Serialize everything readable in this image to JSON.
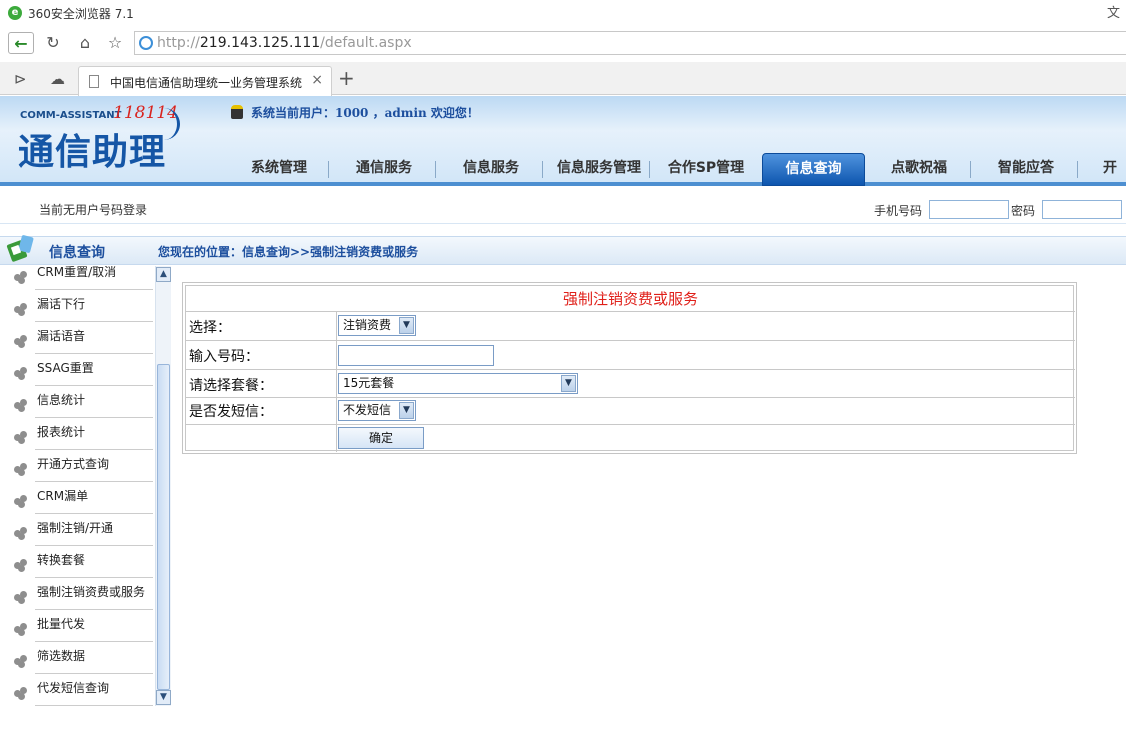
{
  "browser": {
    "title": "360安全浏览器 7.1",
    "right_text": "文",
    "url_scheme": "http://",
    "url_host": "219.143.125.111",
    "url_path": "/default.aspx",
    "tab_title": "中国电信通信助理统一业务管理系统",
    "tab_close": "×",
    "new_tab": "+"
  },
  "header": {
    "brand_en": "COMM-ASSISTANT",
    "brand_num": "118114",
    "brand_cn": "通信助理",
    "user_line": "系统当前用户：1000 ，admin 欢迎您！",
    "menu": [
      {
        "label": "系统管理",
        "active": false
      },
      {
        "label": "通信服务",
        "active": false
      },
      {
        "label": "信息服务",
        "active": false
      },
      {
        "label": "信息服务管理",
        "active": false
      },
      {
        "label": "合作SP管理",
        "active": false
      },
      {
        "label": "信息查询",
        "active": true
      },
      {
        "label": "点歌祝福",
        "active": false
      },
      {
        "label": "智能应答",
        "active": false
      },
      {
        "label": "开机",
        "active": false
      }
    ]
  },
  "login": {
    "status": "当前无用户号码登录",
    "phone_label": "手机号码",
    "password_label": "密码"
  },
  "section": {
    "title": "信息查询",
    "location": "您现在的位置：信息查询>>强制注销资费或服务"
  },
  "sidebar": {
    "items": [
      "CRM重置/取消",
      "漏话下行",
      "漏话语音",
      "SSAG重置",
      "信息统计",
      "报表统计",
      "开通方式查询",
      "CRM漏单",
      "强制注销/开通",
      "转换套餐",
      "强制注销资费或服务",
      "批量代发",
      "筛选数据",
      "代发短信查询"
    ]
  },
  "form": {
    "title": "强制注销资费或服务",
    "select_label": "选择：",
    "select_value": "注销资费",
    "number_label": "输入号码：",
    "number_value": "",
    "package_label": "请选择套餐：",
    "package_value": "15元套餐",
    "sms_label": "是否发短信：",
    "sms_value": "不发短信",
    "submit_label": "确定"
  },
  "colors": {
    "accent": "#0d55ae",
    "form_title": "#e0201a",
    "brand_red": "#d9241f"
  }
}
